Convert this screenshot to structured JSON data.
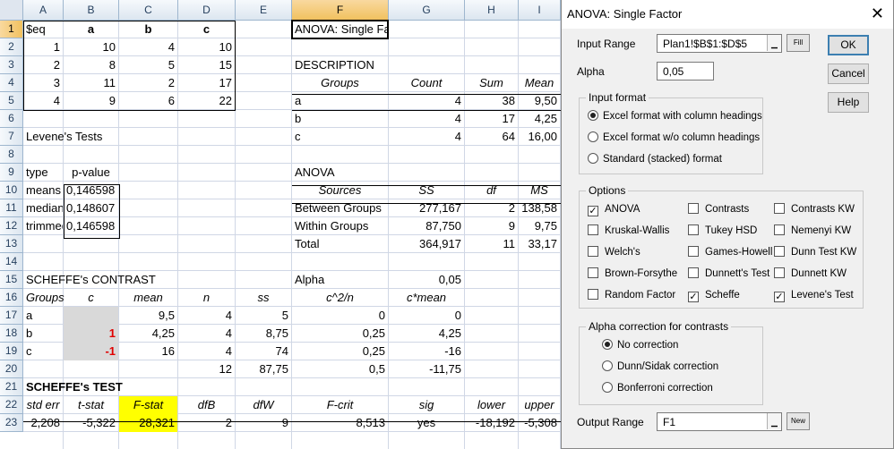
{
  "spreadsheet": {
    "columns": [
      {
        "label": "A",
        "selected": false
      },
      {
        "label": "B",
        "selected": false
      },
      {
        "label": "C",
        "selected": false
      },
      {
        "label": "D",
        "selected": false
      },
      {
        "label": "E",
        "selected": false
      },
      {
        "label": "F",
        "selected": true
      },
      {
        "label": "G",
        "selected": false
      },
      {
        "label": "H",
        "selected": false
      },
      {
        "label": "I",
        "selected": false
      }
    ],
    "rows": [
      "1",
      "2",
      "3",
      "4",
      "5",
      "6",
      "7",
      "8",
      "9",
      "10",
      "11",
      "12",
      "13",
      "14",
      "15",
      "16",
      "17",
      "18",
      "19",
      "20",
      "21",
      "22",
      "23"
    ],
    "selected_row": "1",
    "cells": [
      {
        "col": "A",
        "row": 1,
        "v": "$eq",
        "align": "l"
      },
      {
        "col": "B",
        "row": 1,
        "v": "a",
        "align": "c",
        "style": "b"
      },
      {
        "col": "C",
        "row": 1,
        "v": "b",
        "align": "c",
        "style": "b"
      },
      {
        "col": "D",
        "row": 1,
        "v": "c",
        "align": "c",
        "style": "b"
      },
      {
        "col": "F",
        "row": 1,
        "v": "ANOVA: Single Factor",
        "align": "l"
      },
      {
        "col": "A",
        "row": 2,
        "v": "1",
        "align": "r"
      },
      {
        "col": "B",
        "row": 2,
        "v": "10",
        "align": "r"
      },
      {
        "col": "C",
        "row": 2,
        "v": "4",
        "align": "r"
      },
      {
        "col": "D",
        "row": 2,
        "v": "10",
        "align": "r"
      },
      {
        "col": "A",
        "row": 3,
        "v": "2",
        "align": "r"
      },
      {
        "col": "B",
        "row": 3,
        "v": "8",
        "align": "r"
      },
      {
        "col": "C",
        "row": 3,
        "v": "5",
        "align": "r"
      },
      {
        "col": "D",
        "row": 3,
        "v": "15",
        "align": "r"
      },
      {
        "col": "F",
        "row": 3,
        "v": "DESCRIPTION",
        "align": "l"
      },
      {
        "col": "A",
        "row": 4,
        "v": "3",
        "align": "r"
      },
      {
        "col": "B",
        "row": 4,
        "v": "11",
        "align": "r"
      },
      {
        "col": "C",
        "row": 4,
        "v": "2",
        "align": "r"
      },
      {
        "col": "D",
        "row": 4,
        "v": "17",
        "align": "r"
      },
      {
        "col": "F",
        "row": 4,
        "v": "Groups",
        "align": "c",
        "style": "i"
      },
      {
        "col": "G",
        "row": 4,
        "v": "Count",
        "align": "c",
        "style": "i"
      },
      {
        "col": "H",
        "row": 4,
        "v": "Sum",
        "align": "c",
        "style": "i"
      },
      {
        "col": "I",
        "row": 4,
        "v": "Mean",
        "align": "c",
        "style": "i"
      },
      {
        "col": "A",
        "row": 5,
        "v": "4",
        "align": "r"
      },
      {
        "col": "B",
        "row": 5,
        "v": "9",
        "align": "r"
      },
      {
        "col": "C",
        "row": 5,
        "v": "6",
        "align": "r"
      },
      {
        "col": "D",
        "row": 5,
        "v": "22",
        "align": "r"
      },
      {
        "col": "F",
        "row": 5,
        "v": "a",
        "align": "l"
      },
      {
        "col": "G",
        "row": 5,
        "v": "4",
        "align": "r"
      },
      {
        "col": "H",
        "row": 5,
        "v": "38",
        "align": "r"
      },
      {
        "col": "I",
        "row": 5,
        "v": "9,50",
        "align": "r"
      },
      {
        "col": "F",
        "row": 6,
        "v": "b",
        "align": "l"
      },
      {
        "col": "G",
        "row": 6,
        "v": "4",
        "align": "r"
      },
      {
        "col": "H",
        "row": 6,
        "v": "17",
        "align": "r"
      },
      {
        "col": "I",
        "row": 6,
        "v": "4,25",
        "align": "r"
      },
      {
        "col": "A",
        "row": 7,
        "v": "Levene's Tests",
        "align": "l"
      },
      {
        "col": "F",
        "row": 7,
        "v": "c",
        "align": "l"
      },
      {
        "col": "G",
        "row": 7,
        "v": "4",
        "align": "r"
      },
      {
        "col": "H",
        "row": 7,
        "v": "64",
        "align": "r"
      },
      {
        "col": "I",
        "row": 7,
        "v": "16,00",
        "align": "r"
      },
      {
        "col": "A",
        "row": 9,
        "v": "type",
        "align": "l"
      },
      {
        "col": "B",
        "row": 9,
        "v": "p-value",
        "align": "c"
      },
      {
        "col": "F",
        "row": 9,
        "v": "ANOVA",
        "align": "l"
      },
      {
        "col": "A",
        "row": 10,
        "v": "means",
        "align": "l"
      },
      {
        "col": "B",
        "row": 10,
        "v": "0,146598",
        "align": "l"
      },
      {
        "col": "F",
        "row": 10,
        "v": "Sources",
        "align": "c",
        "style": "i"
      },
      {
        "col": "G",
        "row": 10,
        "v": "SS",
        "align": "c",
        "style": "i"
      },
      {
        "col": "H",
        "row": 10,
        "v": "df",
        "align": "c",
        "style": "i"
      },
      {
        "col": "I",
        "row": 10,
        "v": "MS",
        "align": "c",
        "style": "i"
      },
      {
        "col": "A",
        "row": 11,
        "v": "median",
        "align": "l"
      },
      {
        "col": "B",
        "row": 11,
        "v": "0,148607",
        "align": "l"
      },
      {
        "col": "F",
        "row": 11,
        "v": "Between Groups",
        "align": "l"
      },
      {
        "col": "G",
        "row": 11,
        "v": "277,167",
        "align": "r"
      },
      {
        "col": "H",
        "row": 11,
        "v": "2",
        "align": "r"
      },
      {
        "col": "I",
        "row": 11,
        "v": "138,58",
        "align": "r"
      },
      {
        "col": "A",
        "row": 12,
        "v": "trimmed",
        "align": "l"
      },
      {
        "col": "B",
        "row": 12,
        "v": "0,146598",
        "align": "l"
      },
      {
        "col": "F",
        "row": 12,
        "v": "Within Groups",
        "align": "l"
      },
      {
        "col": "G",
        "row": 12,
        "v": "87,750",
        "align": "r"
      },
      {
        "col": "H",
        "row": 12,
        "v": "9",
        "align": "r"
      },
      {
        "col": "I",
        "row": 12,
        "v": "9,75",
        "align": "r"
      },
      {
        "col": "F",
        "row": 13,
        "v": "Total",
        "align": "l"
      },
      {
        "col": "G",
        "row": 13,
        "v": "364,917",
        "align": "r"
      },
      {
        "col": "H",
        "row": 13,
        "v": "11",
        "align": "r"
      },
      {
        "col": "I",
        "row": 13,
        "v": "33,17",
        "align": "r"
      },
      {
        "col": "A",
        "row": 15,
        "v": "SCHEFFE's CONTRAST",
        "align": "l"
      },
      {
        "col": "F",
        "row": 15,
        "v": "Alpha",
        "align": "l"
      },
      {
        "col": "G",
        "row": 15,
        "v": "0,05",
        "align": "r"
      },
      {
        "col": "A",
        "row": 16,
        "v": "Groups",
        "align": "l",
        "style": "i"
      },
      {
        "col": "B",
        "row": 16,
        "v": "c",
        "align": "c",
        "style": "i"
      },
      {
        "col": "C",
        "row": 16,
        "v": "mean",
        "align": "c",
        "style": "i"
      },
      {
        "col": "D",
        "row": 16,
        "v": "n",
        "align": "c",
        "style": "i"
      },
      {
        "col": "E",
        "row": 16,
        "v": "ss",
        "align": "c",
        "style": "i"
      },
      {
        "col": "F",
        "row": 16,
        "v": "c^2/n",
        "align": "c",
        "style": "i"
      },
      {
        "col": "G",
        "row": 16,
        "v": "c*mean",
        "align": "c",
        "style": "i"
      },
      {
        "col": "A",
        "row": 17,
        "v": "a",
        "align": "l"
      },
      {
        "col": "B",
        "row": 17,
        "v": "",
        "align": "r",
        "fill": "gray"
      },
      {
        "col": "C",
        "row": 17,
        "v": "9,5",
        "align": "r"
      },
      {
        "col": "D",
        "row": 17,
        "v": "4",
        "align": "r"
      },
      {
        "col": "E",
        "row": 17,
        "v": "5",
        "align": "r"
      },
      {
        "col": "F",
        "row": 17,
        "v": "0",
        "align": "r"
      },
      {
        "col": "G",
        "row": 17,
        "v": "0",
        "align": "r"
      },
      {
        "col": "A",
        "row": 18,
        "v": "b",
        "align": "l"
      },
      {
        "col": "B",
        "row": 18,
        "v": "1",
        "align": "r",
        "fill": "gray",
        "style": "red"
      },
      {
        "col": "C",
        "row": 18,
        "v": "4,25",
        "align": "r"
      },
      {
        "col": "D",
        "row": 18,
        "v": "4",
        "align": "r"
      },
      {
        "col": "E",
        "row": 18,
        "v": "8,75",
        "align": "r"
      },
      {
        "col": "F",
        "row": 18,
        "v": "0,25",
        "align": "r"
      },
      {
        "col": "G",
        "row": 18,
        "v": "4,25",
        "align": "r"
      },
      {
        "col": "A",
        "row": 19,
        "v": "c",
        "align": "l"
      },
      {
        "col": "B",
        "row": 19,
        "v": "-1",
        "align": "r",
        "fill": "gray",
        "style": "red"
      },
      {
        "col": "C",
        "row": 19,
        "v": "16",
        "align": "r"
      },
      {
        "col": "D",
        "row": 19,
        "v": "4",
        "align": "r"
      },
      {
        "col": "E",
        "row": 19,
        "v": "74",
        "align": "r"
      },
      {
        "col": "F",
        "row": 19,
        "v": "0,25",
        "align": "r"
      },
      {
        "col": "G",
        "row": 19,
        "v": "-16",
        "align": "r"
      },
      {
        "col": "D",
        "row": 20,
        "v": "12",
        "align": "r"
      },
      {
        "col": "E",
        "row": 20,
        "v": "87,75",
        "align": "r"
      },
      {
        "col": "F",
        "row": 20,
        "v": "0,5",
        "align": "r"
      },
      {
        "col": "G",
        "row": 20,
        "v": "-11,75",
        "align": "r"
      },
      {
        "col": "A",
        "row": 21,
        "v": "SCHEFFE's TEST",
        "align": "l",
        "style": "b"
      },
      {
        "col": "A",
        "row": 22,
        "v": "std err",
        "align": "c",
        "style": "i"
      },
      {
        "col": "B",
        "row": 22,
        "v": "t-stat",
        "align": "c",
        "style": "i"
      },
      {
        "col": "C",
        "row": 22,
        "v": "F-stat",
        "align": "c",
        "style": "i",
        "fill": "yellow"
      },
      {
        "col": "D",
        "row": 22,
        "v": "dfB",
        "align": "c",
        "style": "i"
      },
      {
        "col": "E",
        "row": 22,
        "v": "dfW",
        "align": "c",
        "style": "i"
      },
      {
        "col": "F",
        "row": 22,
        "v": "F-crit",
        "align": "c",
        "style": "i"
      },
      {
        "col": "G",
        "row": 22,
        "v": "sig",
        "align": "c",
        "style": "i"
      },
      {
        "col": "H",
        "row": 22,
        "v": "lower",
        "align": "c",
        "style": "i"
      },
      {
        "col": "I",
        "row": 22,
        "v": "upper",
        "align": "c",
        "style": "i"
      },
      {
        "col": "A",
        "row": 23,
        "v": "2,208",
        "align": "r"
      },
      {
        "col": "B",
        "row": 23,
        "v": "-5,322",
        "align": "r"
      },
      {
        "col": "C",
        "row": 23,
        "v": "28,321",
        "align": "r",
        "fill": "yellow"
      },
      {
        "col": "D",
        "row": 23,
        "v": "2",
        "align": "r"
      },
      {
        "col": "E",
        "row": 23,
        "v": "9",
        "align": "r"
      },
      {
        "col": "F",
        "row": 23,
        "v": "8,513",
        "align": "r"
      },
      {
        "col": "G",
        "row": 23,
        "v": "yes",
        "align": "c"
      },
      {
        "col": "H",
        "row": 23,
        "v": "-18,192",
        "align": "r"
      },
      {
        "col": "I",
        "row": 23,
        "v": "-5,308",
        "align": "r"
      }
    ]
  },
  "dialog": {
    "title": "ANOVA: Single Factor",
    "close_icon": "close-icon",
    "input_range_label": "Input Range",
    "input_range_value": "Plan1!$B$1:$D$5",
    "fill_button": "Fill",
    "alpha_label": "Alpha",
    "alpha_value": "0,05",
    "ok_button": "OK",
    "cancel_button": "Cancel",
    "help_button": "Help",
    "input_format": {
      "label": "Input format",
      "options": [
        {
          "label": "Excel format with column headings",
          "selected": true
        },
        {
          "label": "Excel format w/o column headings",
          "selected": false
        },
        {
          "label": "Standard (stacked) format",
          "selected": false
        }
      ]
    },
    "options": {
      "label": "Options",
      "items": [
        {
          "label": "ANOVA",
          "checked": true
        },
        {
          "label": "Contrasts",
          "checked": false
        },
        {
          "label": "Contrasts KW",
          "checked": false
        },
        {
          "label": "Kruskal-Wallis",
          "checked": false
        },
        {
          "label": "Tukey HSD",
          "checked": false
        },
        {
          "label": "Nemenyi KW",
          "checked": false
        },
        {
          "label": "Welch's",
          "checked": false
        },
        {
          "label": "Games-Howell",
          "checked": false
        },
        {
          "label": "Dunn Test KW",
          "checked": false
        },
        {
          "label": "Brown-Forsythe",
          "checked": false
        },
        {
          "label": "Dunnett's Test",
          "checked": false
        },
        {
          "label": "Dunnett KW",
          "checked": false
        },
        {
          "label": "Random Factor",
          "checked": false
        },
        {
          "label": "Scheffe",
          "checked": true
        },
        {
          "label": "Levene's Test",
          "checked": true
        }
      ]
    },
    "alpha_correction": {
      "label": "Alpha correction for contrasts",
      "options": [
        {
          "label": "No correction",
          "selected": true
        },
        {
          "label": "Dunn/Sidak correction",
          "selected": false
        },
        {
          "label": "Bonferroni correction",
          "selected": false
        }
      ]
    },
    "output_range_label": "Output Range",
    "output_range_value": "F1",
    "new_button": "New"
  }
}
